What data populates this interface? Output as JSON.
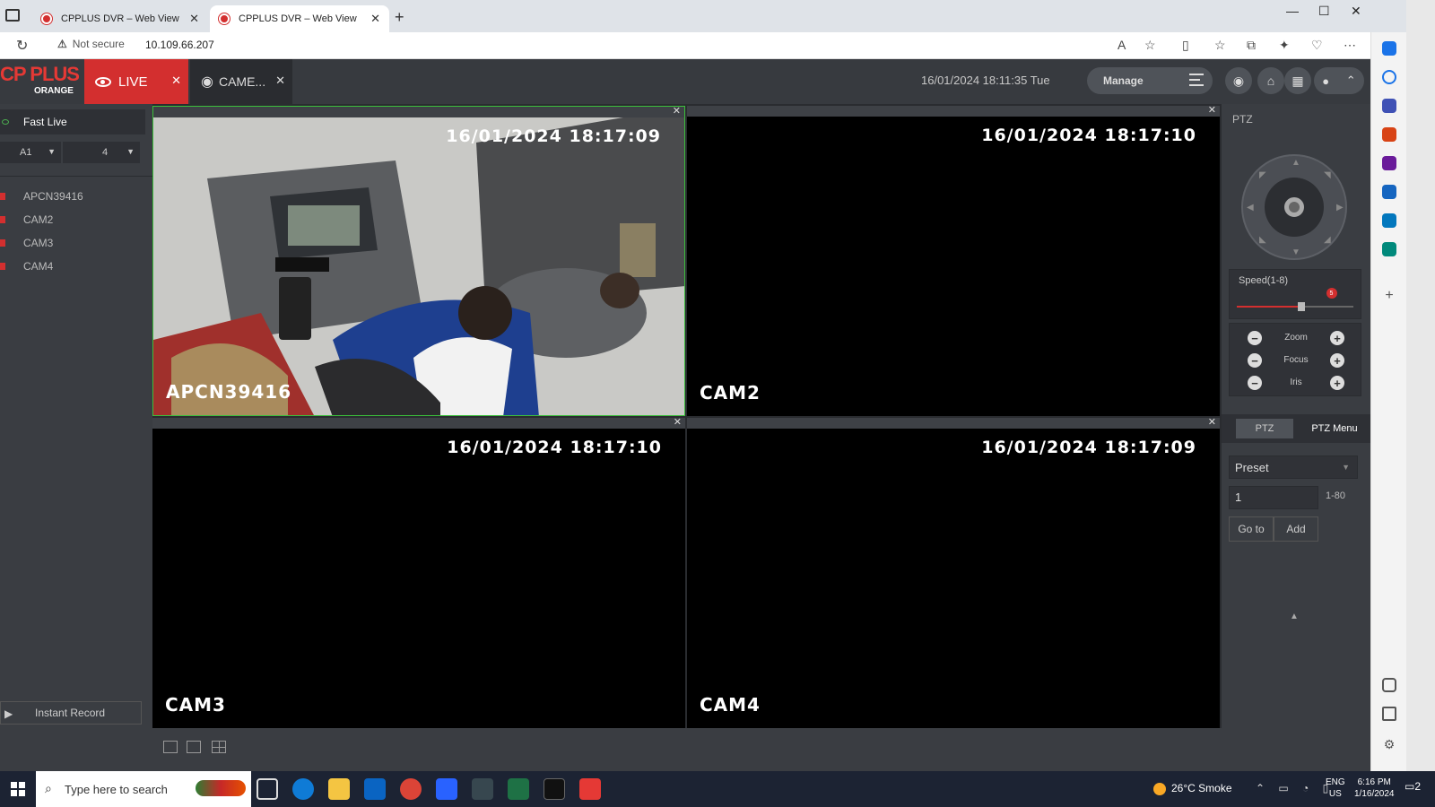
{
  "browser": {
    "tabs": [
      {
        "title": "CPPLUS DVR – Web View"
      },
      {
        "title": "CPPLUS DVR – Web View"
      }
    ],
    "security_label": "Not secure",
    "url": "10.109.66.207"
  },
  "dvr": {
    "logo_top": "CP PLUS",
    "logo_bottom": "ORANGE",
    "tabs": {
      "live": "LIVE",
      "camera": "CAME..."
    },
    "datetime": "16/01/2024 18:11:35 Tue",
    "manage_label": "Manage"
  },
  "left_panel": {
    "fast_live": "Fast Live",
    "stream_selector": "A1",
    "split_selector": "4",
    "cameras": [
      "APCN39416",
      "CAM2",
      "CAM3",
      "CAM4"
    ],
    "instant_record": "Instant Record"
  },
  "tiles": [
    {
      "stamp": "16/01/2024 18:17:09",
      "name": "APCN39416"
    },
    {
      "stamp": "16/01/2024 18:17:10",
      "name": "CAM2"
    },
    {
      "stamp": "16/01/2024 18:17:10",
      "name": "CAM3"
    },
    {
      "stamp": "16/01/2024 18:17:09",
      "name": "CAM4"
    }
  ],
  "ptz": {
    "title": "PTZ",
    "speed_label": "Speed(1-8)",
    "speed_value": "5",
    "speed_fraction": 0.55,
    "zoom_label": "Zoom",
    "focus_label": "Focus",
    "iris_label": "Iris",
    "tab_ptz": "PTZ",
    "tab_menu": "PTZ Menu",
    "preset_label": "Preset",
    "preset_value": "1",
    "preset_range": "1-80",
    "goto_label": "Go to",
    "add_label": "Add"
  },
  "taskbar": {
    "search_placeholder": "Type here to search",
    "weather": "26°C  Smoke",
    "lang_line1": "ENG",
    "lang_line2": "US",
    "time": "6:16 PM",
    "date": "1/16/2024",
    "notification_count": "2"
  },
  "colors": {
    "accent_red": "#d32f2f",
    "header_bg": "#373a3f",
    "panel_bg": "#3a3d42",
    "active_tile_border": "#3bbf3b"
  }
}
